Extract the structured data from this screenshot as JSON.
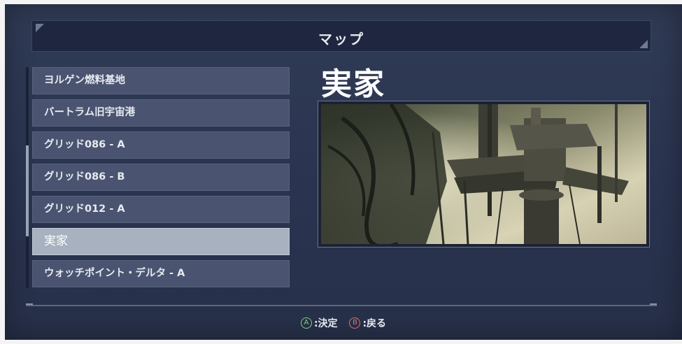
{
  "header": {
    "title": "マップ"
  },
  "map_list": {
    "items": [
      {
        "label": "ヨルゲン燃料基地"
      },
      {
        "label": "バートラム旧宇宙港"
      },
      {
        "label": "グリッド086 - A"
      },
      {
        "label": "グリッド086 - B"
      },
      {
        "label": "グリッド012 - A"
      },
      {
        "label": "実家"
      },
      {
        "label": "ウォッチポイント・デルタ - A"
      }
    ],
    "selected_index": 5
  },
  "detail": {
    "title": "実家"
  },
  "footer": {
    "confirm": {
      "button": "A",
      "label": ":決定"
    },
    "back": {
      "button": "B",
      "label": ":戻る"
    }
  },
  "colors": {
    "background": "#2c3650",
    "list_item": "#4a5470",
    "list_item_selected": "#a7b1c0",
    "accent_a": "#7fd07f",
    "accent_b": "#e07070"
  }
}
